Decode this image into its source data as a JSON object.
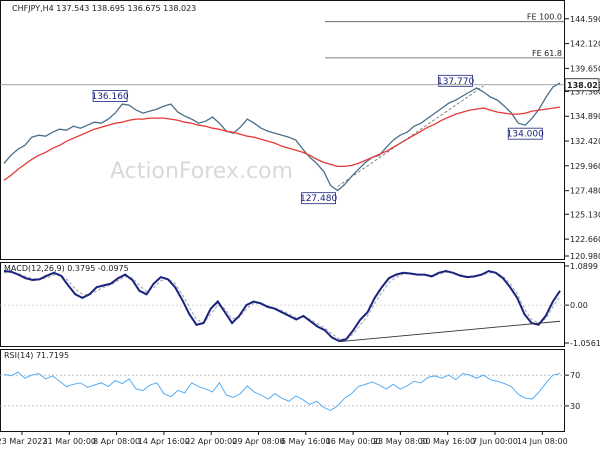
{
  "chart_data": {
    "type": "line",
    "symbol_header": "CHFJPY,H4  137.543 138.695 136.675 138.023",
    "watermark": "ActionForex.com",
    "x_tick_labels": [
      "23 Mar 2022",
      "31 Mar 00:00",
      "8 Apr 08:00",
      "14 Apr 16:00",
      "22 Apr 00:00",
      "29 Apr 08:00",
      "6 May 16:00",
      "16 May 00:00",
      "23 May 08:00",
      "30 May 16:00",
      "7 Jun 00:00",
      "14 Jun 08:00"
    ],
    "price_panel": {
      "ylim": [
        120.98,
        146.06
      ],
      "y_tick_labels": [
        "144.590",
        "142.120",
        "139.650",
        "137.360",
        "134.890",
        "132.420",
        "129.960",
        "127.480",
        "125.130",
        "122.660",
        "120.980"
      ],
      "current_price_label": "138.023",
      "current_price": 138.023,
      "series": [
        {
          "name": "",
          "color": "#4a6f8a",
          "values": [
            130.2,
            131.0,
            131.6,
            132.0,
            132.8,
            133.0,
            132.9,
            133.3,
            133.6,
            133.5,
            133.9,
            133.7,
            134.0,
            134.3,
            134.2,
            134.6,
            135.2,
            136.1,
            136.0,
            135.5,
            135.2,
            135.4,
            135.6,
            135.9,
            136.1,
            135.3,
            134.9,
            134.6,
            134.2,
            134.4,
            134.8,
            134.2,
            133.4,
            133.2,
            133.8,
            134.6,
            134.2,
            133.7,
            133.4,
            133.2,
            133.0,
            132.8,
            132.5,
            131.6,
            130.8,
            130.2,
            129.4,
            128.0,
            127.5,
            128.1,
            128.9,
            129.6,
            130.3,
            130.8,
            131.0,
            131.8,
            132.5,
            133.0,
            133.3,
            133.9,
            134.2,
            134.7,
            135.2,
            135.7,
            136.2,
            136.5,
            136.9,
            137.3,
            137.7,
            137.3,
            136.8,
            136.5,
            135.9,
            135.2,
            134.2,
            134.0,
            134.7,
            135.6,
            136.8,
            137.8,
            138.2
          ]
        },
        {
          "name": "",
          "color": "#e53935",
          "values": [
            128.5,
            129.0,
            129.6,
            130.1,
            130.6,
            131.0,
            131.3,
            131.7,
            132.0,
            132.4,
            132.7,
            133.0,
            133.3,
            133.6,
            133.8,
            134.0,
            134.2,
            134.3,
            134.5,
            134.6,
            134.6,
            134.7,
            134.7,
            134.7,
            134.6,
            134.5,
            134.3,
            134.2,
            134.0,
            133.9,
            133.7,
            133.6,
            133.4,
            133.3,
            133.1,
            132.9,
            132.8,
            132.6,
            132.4,
            132.2,
            131.9,
            131.7,
            131.5,
            131.3,
            131.0,
            130.6,
            130.3,
            130.1,
            129.9,
            129.9,
            130.0,
            130.2,
            130.5,
            130.8,
            131.1,
            131.4,
            131.8,
            132.2,
            132.6,
            133.0,
            133.4,
            133.8,
            134.1,
            134.5,
            134.8,
            135.1,
            135.3,
            135.5,
            135.6,
            135.7,
            135.5,
            135.3,
            135.2,
            135.1,
            135.1,
            135.2,
            135.4,
            135.5,
            135.6,
            135.7,
            135.8
          ]
        }
      ],
      "fe_levels": [
        {
          "label": "FE 100.0",
          "value": 144.3
        },
        {
          "label": "FE 61.8",
          "value": 140.7
        }
      ],
      "annotations": [
        {
          "label": "136.160",
          "index": 18,
          "value": 136.16
        },
        {
          "label": "127.480",
          "index": 48,
          "value": 127.48
        },
        {
          "label": "137.770",
          "index": 68,
          "value": 137.77
        },
        {
          "label": "134.000",
          "index": 75,
          "value": 134.0
        }
      ]
    },
    "macd_panel": {
      "title": "MACD(12,26,9) 0.3795 -0.0975",
      "ylim": [
        -1.0561,
        1.0899
      ],
      "y_tick_labels": [
        "1.0899",
        "0.00",
        "-1.0561"
      ],
      "macd": [
        0.95,
        0.93,
        0.85,
        0.75,
        0.7,
        0.72,
        0.82,
        0.9,
        0.82,
        0.55,
        0.3,
        0.2,
        0.3,
        0.5,
        0.55,
        0.6,
        0.75,
        0.85,
        0.7,
        0.4,
        0.3,
        0.6,
        0.78,
        0.72,
        0.5,
        0.15,
        -0.25,
        -0.55,
        -0.5,
        -0.1,
        0.1,
        -0.2,
        -0.5,
        -0.3,
        0.0,
        0.1,
        0.05,
        -0.05,
        -0.1,
        -0.2,
        -0.3,
        -0.4,
        -0.3,
        -0.45,
        -0.6,
        -0.7,
        -0.9,
        -1.0,
        -0.95,
        -0.7,
        -0.4,
        -0.2,
        0.2,
        0.5,
        0.75,
        0.85,
        0.9,
        0.88,
        0.85,
        0.85,
        0.8,
        0.9,
        0.95,
        0.9,
        0.82,
        0.78,
        0.8,
        0.85,
        0.95,
        0.9,
        0.75,
        0.5,
        0.2,
        -0.25,
        -0.5,
        -0.55,
        -0.3,
        0.1,
        0.4
      ],
      "signal": [
        0.9,
        0.92,
        0.88,
        0.8,
        0.74,
        0.72,
        0.76,
        0.84,
        0.84,
        0.68,
        0.45,
        0.3,
        0.28,
        0.4,
        0.5,
        0.56,
        0.68,
        0.8,
        0.76,
        0.55,
        0.38,
        0.48,
        0.68,
        0.74,
        0.6,
        0.3,
        -0.05,
        -0.4,
        -0.5,
        -0.25,
        0.0,
        -0.1,
        -0.38,
        -0.35,
        -0.1,
        0.05,
        0.05,
        -0.02,
        -0.08,
        -0.16,
        -0.25,
        -0.35,
        -0.32,
        -0.4,
        -0.52,
        -0.64,
        -0.8,
        -0.94,
        -0.95,
        -0.8,
        -0.55,
        -0.3,
        0.05,
        0.35,
        0.62,
        0.78,
        0.86,
        0.88,
        0.86,
        0.85,
        0.82,
        0.86,
        0.92,
        0.9,
        0.85,
        0.8,
        0.8,
        0.83,
        0.9,
        0.9,
        0.8,
        0.6,
        0.32,
        -0.1,
        -0.4,
        -0.5,
        -0.38,
        -0.05,
        0.25
      ]
    },
    "rsi_panel": {
      "title": "RSI(14) 71.7195",
      "ylim": [
        0,
        100
      ],
      "y_tick_labels": [
        "70",
        "30"
      ],
      "levels": [
        70,
        30
      ],
      "values": [
        71,
        69,
        74,
        66,
        70,
        72,
        65,
        69,
        62,
        55,
        58,
        60,
        54,
        57,
        60,
        55,
        63,
        59,
        65,
        52,
        50,
        57,
        60,
        46,
        42,
        50,
        47,
        60,
        55,
        52,
        48,
        60,
        44,
        41,
        46,
        56,
        48,
        44,
        39,
        46,
        40,
        36,
        43,
        38,
        32,
        36,
        28,
        24,
        30,
        40,
        46,
        55,
        58,
        61,
        57,
        52,
        58,
        52,
        56,
        62,
        60,
        67,
        69,
        66,
        70,
        64,
        72,
        70,
        66,
        70,
        64,
        62,
        59,
        55,
        45,
        40,
        39,
        48,
        60,
        70,
        72
      ]
    }
  }
}
